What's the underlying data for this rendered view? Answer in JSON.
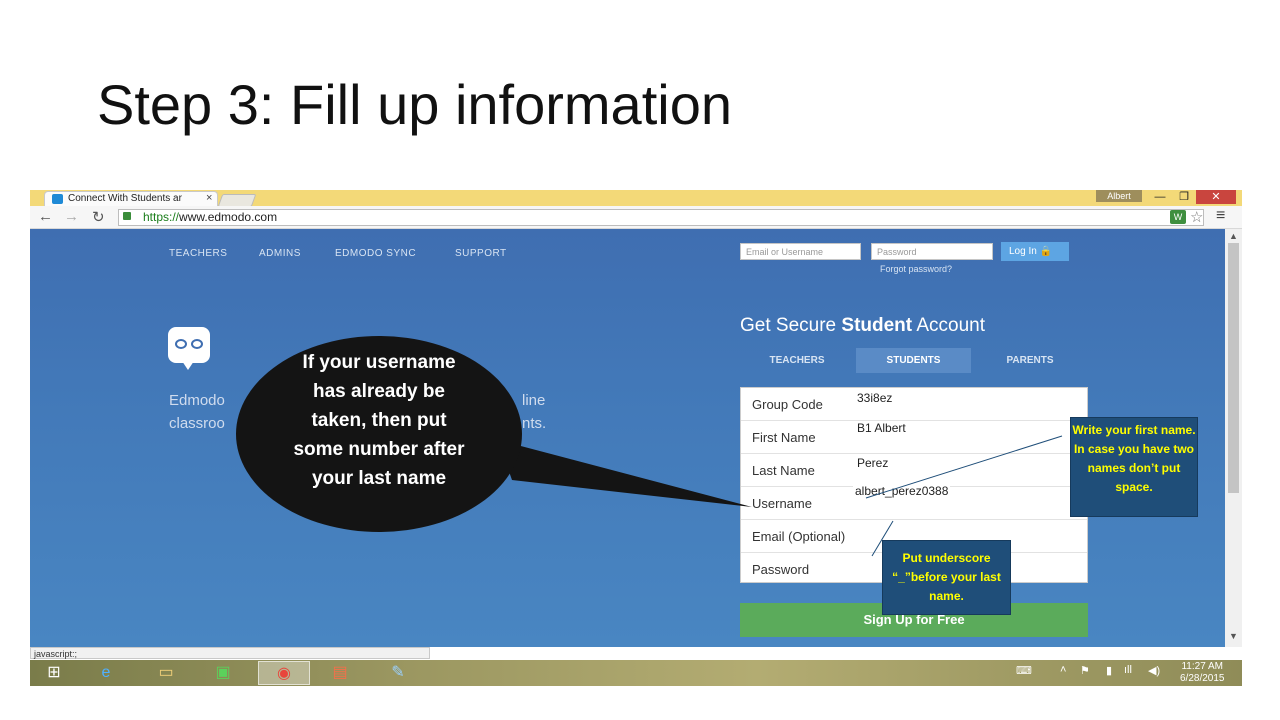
{
  "slide": {
    "title": "Step 3: Fill up information"
  },
  "browser": {
    "tab_title": "Connect With Students ar",
    "tab_close": "×",
    "profile": "Albert",
    "win_min": "—",
    "win_max": "❐",
    "win_close": "✕",
    "url_scheme": "https://",
    "url_host": "www.edmodo.com",
    "status_text": "javascript:;"
  },
  "site": {
    "nav": [
      "TEACHERS",
      "ADMINS",
      "EDMODO SYNC",
      "SUPPORT"
    ],
    "login": {
      "email_placeholder": "Email or Username",
      "password_placeholder": "Password",
      "button": "Log In",
      "forgot": "Forgot password?"
    },
    "bg_text": {
      "line1_left": "Edmodo",
      "line1_right": "line",
      "line2_left": "classroo",
      "line2_right": "nts."
    },
    "headline": {
      "pre": "Get Secure ",
      "bold": "Student",
      "post": " Account"
    },
    "role_tabs": [
      "TEACHERS",
      "STUDENTS",
      "PARENTS"
    ],
    "active_role": "STUDENTS",
    "form": [
      {
        "label": "Group Code",
        "value": "33i8ez"
      },
      {
        "label": "First Name",
        "value": "B1 Albert"
      },
      {
        "label": "Last Name",
        "value": "Perez"
      },
      {
        "label": "Username",
        "value": "albert_perez0388"
      },
      {
        "label": "Email (Optional)",
        "value": ""
      },
      {
        "label": "Password",
        "value": ""
      }
    ],
    "signup_button": "Sign Up for Free"
  },
  "taskbar": {
    "items": [
      "start-icon",
      "internet-explorer-icon",
      "file-explorer-icon",
      "store-icon",
      "chrome-icon",
      "photos-icon",
      "paint-icon"
    ],
    "time": "11:27 AM",
    "date": "6/28/2015"
  },
  "callouts": {
    "speech": "If your username has already be taken, then put some number after your last name",
    "first_name_note": "Write your first name. In case you have two names don’t put space.",
    "underscore_note": "Put underscore “_”before your last name."
  },
  "colors": {
    "page_blue": "#4278b8",
    "signup_green": "#5bab5b",
    "note_bg": "#1f4e79",
    "note_text": "#ffff00",
    "bubble": "#141414"
  }
}
